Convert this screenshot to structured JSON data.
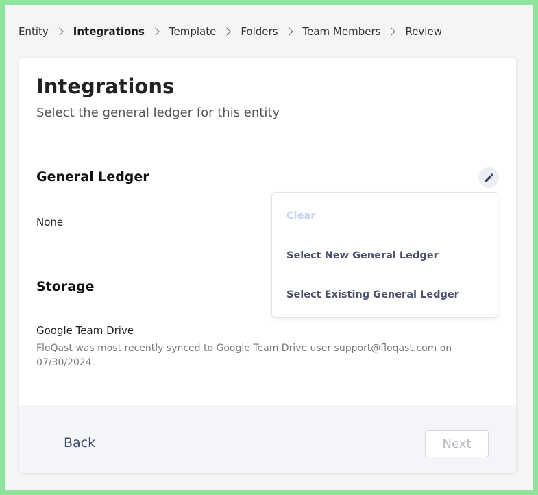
{
  "breadcrumb": {
    "items": [
      "Entity",
      "Integrations",
      "Template",
      "Folders",
      "Team Members",
      "Review"
    ],
    "active_index": 1
  },
  "header": {
    "title": "Integrations",
    "subtitle": "Select the general ledger for this entity"
  },
  "general_ledger": {
    "title": "General Ledger",
    "value": "None",
    "edit_icon": "pencil-icon"
  },
  "dropdown": {
    "clear_label": "Clear",
    "select_new_label": "Select New General Ledger",
    "select_existing_label": "Select Existing General Ledger"
  },
  "storage": {
    "title": "Storage",
    "value": "Google Team Drive",
    "description": "FloQast was most recently synced to Google Team Drive user support@floqast.com on 07/30/2024."
  },
  "footer": {
    "back_label": "Back",
    "next_label": "Next"
  },
  "colors": {
    "frame_border": "#8fe39b",
    "accent_text": "#3f4a6b",
    "disabled_text": "#c8d3ee"
  }
}
